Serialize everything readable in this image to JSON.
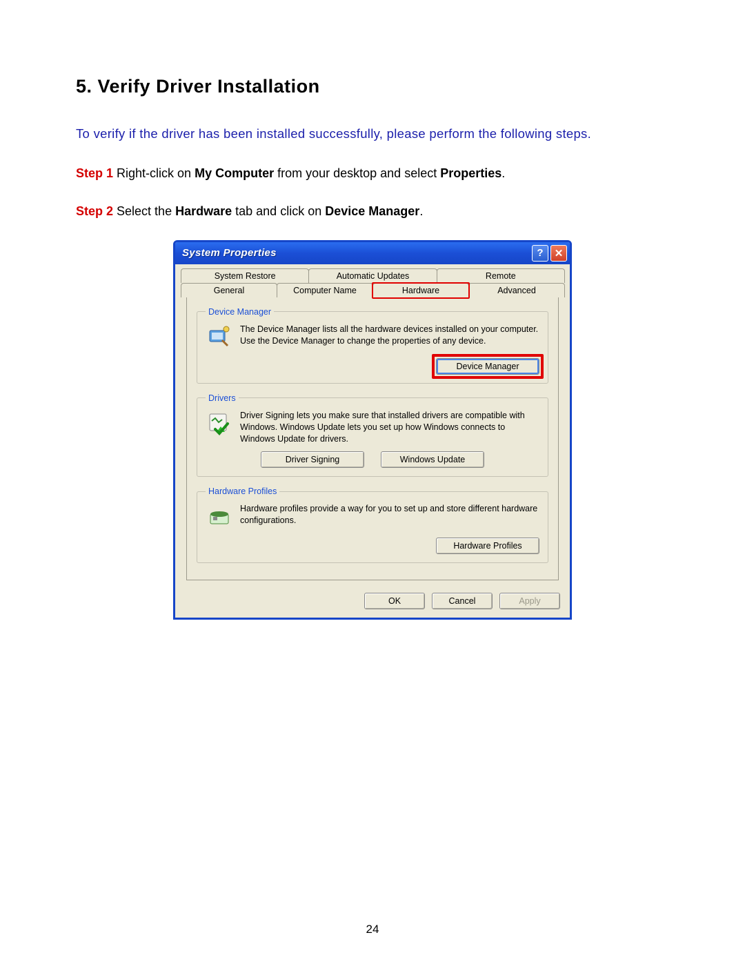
{
  "heading": "5. Verify Driver Installation",
  "intro": "To verify if the driver has been installed successfully, please perform the following steps.",
  "steps": [
    {
      "label": "Step 1",
      "pre": " Right-click on ",
      "b1": "My Computer",
      "mid": " from your desktop and select ",
      "b2": "Properties",
      "post": "."
    },
    {
      "label": "Step 2",
      "pre": " Select the ",
      "b1": "Hardware",
      "mid": " tab and click on ",
      "b2": "Device Manager",
      "post": "."
    }
  ],
  "dialog": {
    "title": "System Properties",
    "help": "?",
    "close": "✕",
    "tabs_row1": [
      "System Restore",
      "Automatic Updates",
      "Remote"
    ],
    "tabs_row2": [
      "General",
      "Computer Name",
      "Hardware",
      "Advanced"
    ],
    "groups": {
      "device_manager": {
        "legend": "Device Manager",
        "desc": "The Device Manager lists all the hardware devices installed on your computer. Use the Device Manager to change the properties of any device.",
        "button": "Device Manager"
      },
      "drivers": {
        "legend": "Drivers",
        "desc": "Driver Signing lets you make sure that installed drivers are compatible with Windows. Windows Update lets you set up how Windows connects to Windows Update for drivers.",
        "button1": "Driver Signing",
        "button2": "Windows Update"
      },
      "hardware_profiles": {
        "legend": "Hardware Profiles",
        "desc": "Hardware profiles provide a way for you to set up and store different hardware configurations.",
        "button": "Hardware Profiles"
      }
    },
    "footer": {
      "ok": "OK",
      "cancel": "Cancel",
      "apply": "Apply"
    }
  },
  "page_number": "24"
}
